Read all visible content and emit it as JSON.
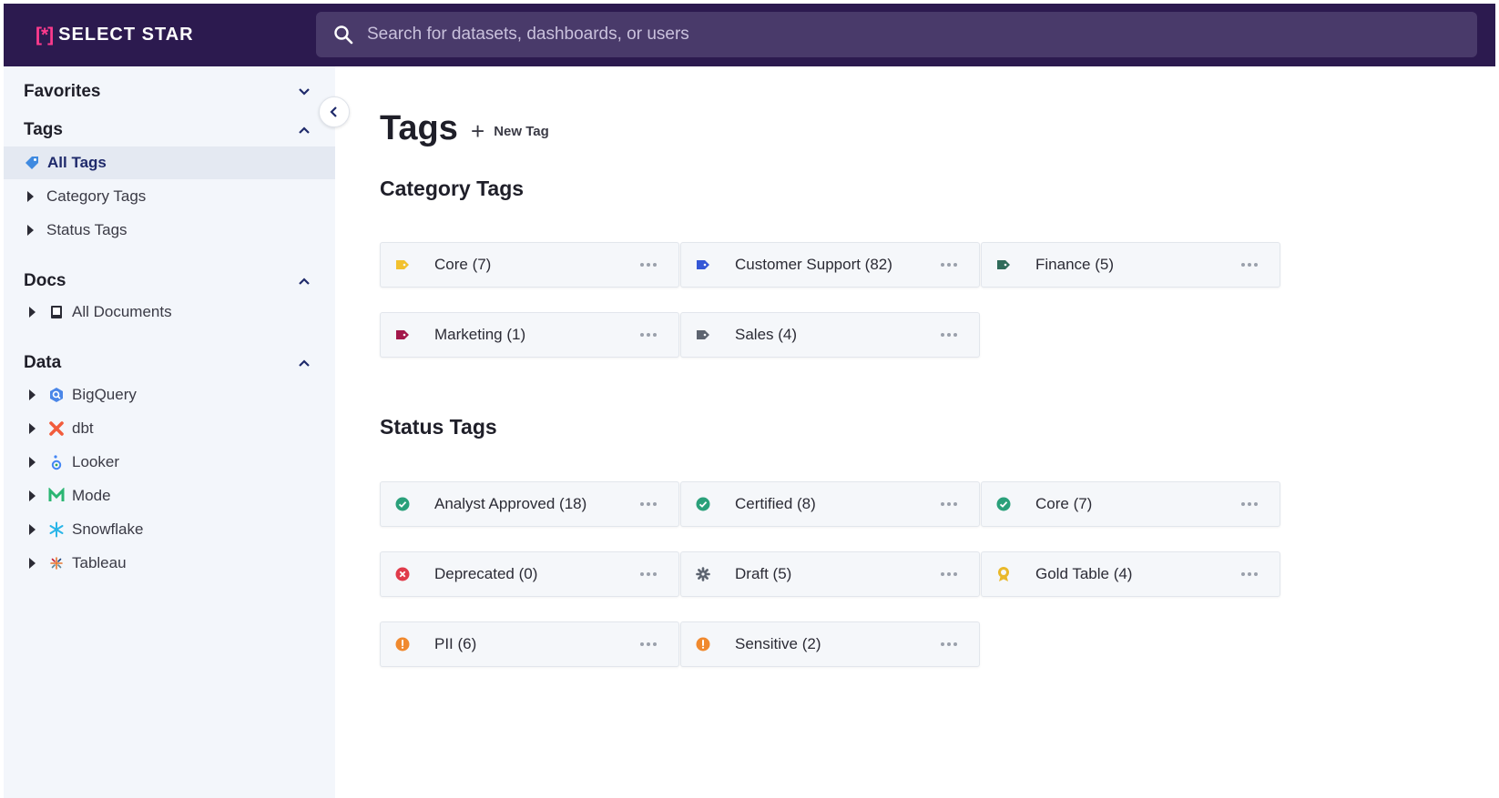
{
  "app": {
    "logo_mark": "[*]",
    "logo_text": "SELECT STAR"
  },
  "search": {
    "placeholder": "Search for datasets, dashboards, or users",
    "icon": "search-icon"
  },
  "sidebar": {
    "favorites": {
      "label": "Favorites"
    },
    "tags": {
      "label": "Tags",
      "items": [
        {
          "label": "All Tags",
          "icon": "tag-icon"
        },
        {
          "label": "Category Tags"
        },
        {
          "label": "Status Tags"
        }
      ]
    },
    "docs": {
      "label": "Docs",
      "items": [
        {
          "label": "All Documents",
          "icon": "book-icon"
        }
      ]
    },
    "data": {
      "label": "Data",
      "items": [
        {
          "label": "BigQuery",
          "icon": "bigquery-icon"
        },
        {
          "label": "dbt",
          "icon": "dbt-icon"
        },
        {
          "label": "Looker",
          "icon": "looker-icon"
        },
        {
          "label": "Mode",
          "icon": "mode-icon"
        },
        {
          "label": "Snowflake",
          "icon": "snowflake-icon"
        },
        {
          "label": "Tableau",
          "icon": "tableau-icon"
        }
      ]
    }
  },
  "main": {
    "title": "Tags",
    "new_tag_label": "New Tag",
    "category_section": {
      "title": "Category Tags",
      "tags": [
        {
          "label": "Core (7)",
          "color": "#f2c12e",
          "icon": "tag-icon"
        },
        {
          "label": "Customer Support (82)",
          "color": "#3557d6",
          "icon": "tag-icon"
        },
        {
          "label": "Finance (5)",
          "color": "#2f6b5a",
          "icon": "tag-icon"
        },
        {
          "label": "Marketing (1)",
          "color": "#a3174a",
          "icon": "tag-icon"
        },
        {
          "label": "Sales (4)",
          "color": "#5d6470",
          "icon": "tag-icon"
        }
      ]
    },
    "status_section": {
      "title": "Status Tags",
      "tags": [
        {
          "label": "Analyst Approved (18)",
          "color": "#2aa07a",
          "icon": "check-circle-icon"
        },
        {
          "label": "Certified (8)",
          "color": "#2aa07a",
          "icon": "check-circle-icon"
        },
        {
          "label": "Core (7)",
          "color": "#2aa07a",
          "icon": "check-circle-icon"
        },
        {
          "label": "Deprecated (0)",
          "color": "#e03a4a",
          "icon": "x-circle-icon"
        },
        {
          "label": "Draft (5)",
          "color": "#5d6470",
          "icon": "gear-icon"
        },
        {
          "label": "Gold Table (4)",
          "color": "#e9b82a",
          "icon": "award-icon"
        },
        {
          "label": "PII (6)",
          "color": "#f0892e",
          "icon": "alert-circle-icon"
        },
        {
          "label": "Sensitive (2)",
          "color": "#f0892e",
          "icon": "alert-circle-icon"
        }
      ]
    }
  }
}
